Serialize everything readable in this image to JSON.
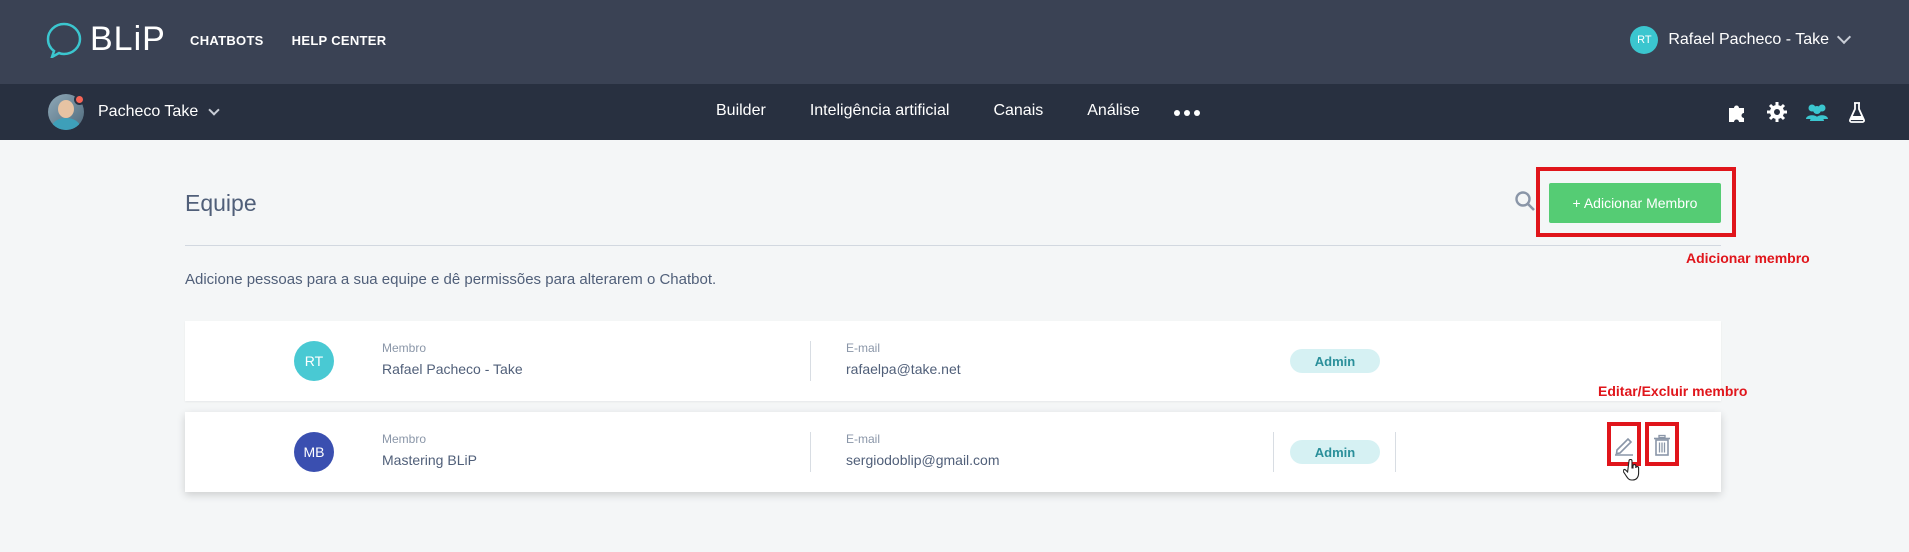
{
  "header": {
    "logo_text": "BLiP",
    "nav": [
      "CHATBOTS",
      "HELP CENTER"
    ],
    "user": {
      "initials": "RT",
      "name": "Rafael Pacheco - Take"
    }
  },
  "subheader": {
    "bot_name": "Pacheco Take",
    "nav": [
      "Builder",
      "Inteligência artificial",
      "Canais",
      "Análise"
    ],
    "tool_icons": [
      "puzzle-icon",
      "gear-icon",
      "team-icon",
      "flask-icon"
    ]
  },
  "main": {
    "title": "Equipe",
    "add_button": "+ Adicionar Membro",
    "intro": "Adicione pessoas para a sua equipe e dê permissões para alterarem o Chatbot.",
    "annotations": {
      "add": "Adicionar membro",
      "edit": "Editar/Excluir membro"
    },
    "members": [
      {
        "initials": "RT",
        "member_label": "Membro",
        "name": "Rafael Pacheco - Take",
        "email_label": "E-mail",
        "email": "rafaelpa@take.net",
        "role": "Admin",
        "avatar_color": "#49c9d3"
      },
      {
        "initials": "MB",
        "member_label": "Membro",
        "name": "Mastering BLiP",
        "email_label": "E-mail",
        "email": "sergiodoblip@gmail.com",
        "role": "Admin",
        "avatar_color": "#3a4fb0"
      }
    ]
  },
  "colors": {
    "topbar": "#3a4254",
    "subbar": "#283040",
    "accent": "#55cc74",
    "annotation": "#e0151b"
  }
}
